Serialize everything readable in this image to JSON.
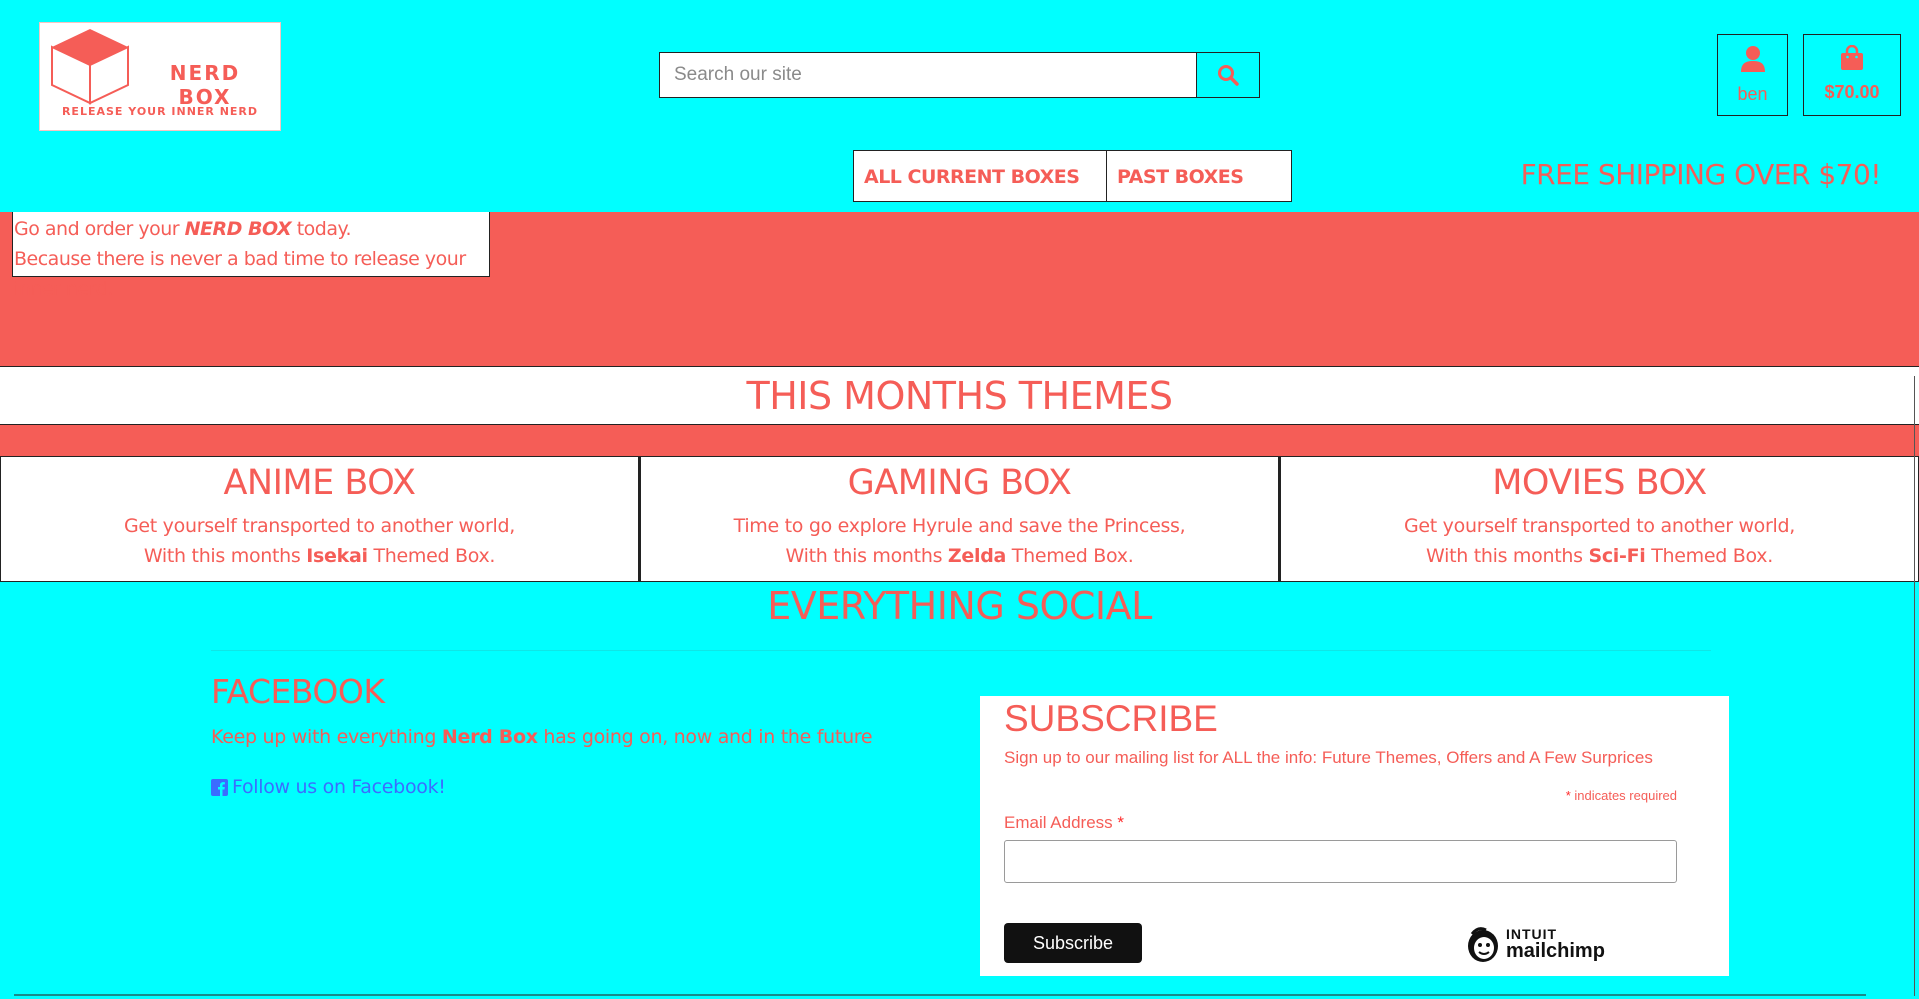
{
  "header": {
    "logo_title": "NERD BOX",
    "logo_tagline": "RELEASE YOUR INNER NERD",
    "search_placeholder": "Search our site",
    "account_label": "ben",
    "cart_label": "$70.00",
    "nav": [
      "ALL CURRENT BOXES",
      "PAST BOXES"
    ],
    "shipping_text": "FREE SHIPPING OVER $70!",
    "icons": {
      "search": "search-icon",
      "account": "user-icon",
      "cart": "shopping-bag-icon"
    }
  },
  "hero": {
    "line1_prefix": "Go and order your ",
    "line1_brand": "NERD BOX",
    "line1_suffix": " today.",
    "line2": "Because there is never a bad time to release your inner nerd."
  },
  "themes": {
    "title": "THIS MONTHS THEMES",
    "cards": [
      {
        "title": "ANIME BOX",
        "line1": "Get yourself transported to another world,",
        "line2_prefix": "With this months ",
        "line2_bold": "Isekai",
        "line2_suffix": " Themed Box."
      },
      {
        "title": "GAMING BOX",
        "line1": "Time to go explore Hyrule and save the Princess,",
        "line2_prefix": "With this months ",
        "line2_bold": "Zelda",
        "line2_suffix": " Themed Box."
      },
      {
        "title": "MOVIES BOX",
        "line1": "Get yourself transported to another world,",
        "line2_prefix": "With this months ",
        "line2_bold": "Sci-Fi",
        "line2_suffix": " Themed Box."
      }
    ]
  },
  "social": {
    "title": "EVERYTHING SOCIAL",
    "facebook_title": "FACEBOOK",
    "facebook_text_prefix": "Keep up with everything ",
    "facebook_text_bold": "Nerd Box",
    "facebook_text_suffix": " has going on, now and in the future",
    "facebook_link": "Follow us on Facebook!"
  },
  "subscribe": {
    "title": "SUBSCRIBE",
    "description": "Sign up to our mailing list for ALL the info: Future Themes, Offers and A Few Surprices",
    "required_star": "*",
    "required_note": " indicates required",
    "email_label": "Email Address ",
    "email_star": "*",
    "button_label": "Subscribe",
    "badge_top": "INTUIT",
    "badge_bottom": "mailchimp"
  },
  "colors": {
    "background": "#00ffff",
    "accent": "#f55d57",
    "link": "#3b6dff"
  }
}
